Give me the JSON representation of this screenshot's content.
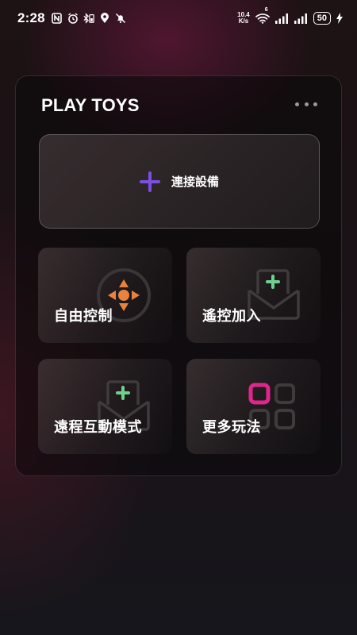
{
  "status_bar": {
    "time": "2:28",
    "net_speed_value": "10.4",
    "net_speed_unit": "K/s",
    "network_type": "6",
    "battery": "50"
  },
  "card": {
    "title": "PLAY TOYS",
    "connect_label": "連接設備",
    "tiles": [
      {
        "label": "自由控制",
        "icon": "joystick-icon"
      },
      {
        "label": "遙控加入",
        "icon": "envelope-plus-icon"
      },
      {
        "label": "遠程互動模式",
        "icon": "envelope-plus-icon"
      },
      {
        "label": "更多玩法",
        "icon": "grid-apps-icon"
      }
    ]
  },
  "colors": {
    "accent_purple": "#7b4fe0",
    "joystick_orange": "#e8823e",
    "plus_green": "#6fcf8f",
    "highlight_pink": "#e0258c"
  }
}
